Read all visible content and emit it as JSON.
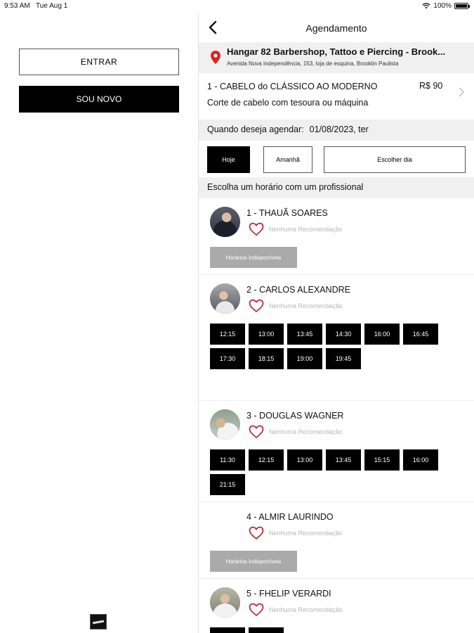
{
  "status_bar": {
    "time": "9:53 AM",
    "date": "Tue Aug 1",
    "battery": "100%"
  },
  "left": {
    "login_label": "ENTRAR",
    "signup_label": "SOU NOVO"
  },
  "header": {
    "title": "Agendamento"
  },
  "shop": {
    "name": "Hangar 82 Barbershop, Tattoo e Piercing - Brook...",
    "address": "Avenida Nova Independência, 153, loja de esquina, Brooklin Paulista"
  },
  "service": {
    "title": "1 - CABELO do CLÁSSICO AO MODERNO",
    "price": "R$ 90",
    "description": "Corte de cabelo com tesoura ou máquina"
  },
  "date_select": {
    "label": "Quando deseja agendar:",
    "value": "01/08/2023, ter"
  },
  "day_buttons": {
    "today": "Hoje",
    "tomorrow": "Amanhã",
    "choose": "Escolher dia"
  },
  "section_title": "Escolha um horário com um profissional",
  "professionals": [
    {
      "name": "1 - THAUÃ SOARES",
      "recommendation": "Nenhuma Recomendação",
      "unavailable": "Horários indisponíveis",
      "slots": []
    },
    {
      "name": "2 - CARLOS ALEXANDRE",
      "recommendation": "Nenhuma Recomendação",
      "slots": [
        "12:15",
        "13:00",
        "13:45",
        "14:30",
        "16:00",
        "16:45",
        "17:30",
        "18:15",
        "19:00",
        "19:45"
      ]
    },
    {
      "name": "3 - DOUGLAS WAGNER",
      "recommendation": "Nenhuma Recomendação",
      "slots": [
        "11:30",
        "12:15",
        "13:00",
        "13:45",
        "15:15",
        "16:00",
        "21:15"
      ]
    },
    {
      "name": "4 - ALMIR LAURINDO",
      "recommendation": "Nenhuma Recomendação",
      "unavailable": "Horários indisponíveis",
      "slots": []
    },
    {
      "name": "5 - FHELIP VERARDI",
      "recommendation": "Nenhuma Recomendação",
      "slots": [
        "",
        ""
      ]
    }
  ],
  "icons": {
    "back": "chevron-left-icon",
    "pin": "location-pin-icon",
    "heart": "heart-outline-icon",
    "wifi": "wifi-icon",
    "battery": "battery-icon"
  },
  "colors": {
    "accent": "#000000",
    "pin": "#e02020",
    "heart": "#c0212b",
    "unavailable": "#aaaaaa",
    "section_bg": "#f0f0f0"
  }
}
